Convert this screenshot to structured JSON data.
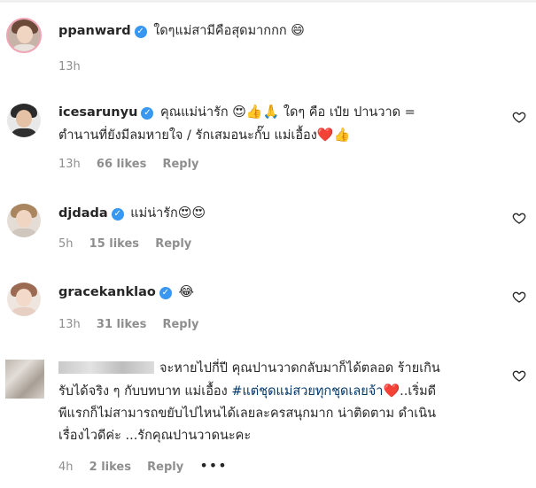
{
  "comments": [
    {
      "username": "ppanward",
      "text": "ใดๆแม่สามีคือสุดมากกก",
      "emoji": "😄",
      "time": "13h"
    },
    {
      "username": "icesarunyu",
      "text_a": "คุณแม่น่ารัก",
      "emoji_a": "😍👍🙏",
      "text_b": "ใดๆ คือ เป๋ย ปานวาด =",
      "text_line2": "ตำนานที่ยังมีลมหายใจ / รักเสมอนะกั๊บ แม่เอื้อง",
      "emoji_end": "❤️👍",
      "time": "13h",
      "likes": "66 likes",
      "reply": "Reply"
    },
    {
      "username": "djdada",
      "text": "แม่น่ารัก",
      "emoji": "😍😍",
      "time": "5h",
      "likes": "15 likes",
      "reply": "Reply"
    },
    {
      "username": "gracekanklao",
      "text": "",
      "emoji": "😂",
      "time": "13h",
      "likes": "31 likes",
      "reply": "Reply"
    },
    {
      "line1": "จะหายไปกี่ปี คุณปานวาดกลับมาก็ได้ตลอด ร้ายเกิน",
      "line2_a": "รับได้จริง ๆ กับบทบาท แม่เอื้อง",
      "hashtag": "#แต่ชุดแม่สวยทุกชุดเลยจ้า",
      "line2_heart": "❤️",
      "line2_b": "..เริ่มดี",
      "line3": "พีแรกก็ไม่สามารถขยับไปไหนได้เลยละครสนุกมาก น่าติดตาม ดำเนิน",
      "line4": "เรื่องไวดีค่ะ ...รักคุณปานวาดนะคะ",
      "time": "4h",
      "likes": "2 likes",
      "reply": "Reply",
      "more": "•••"
    }
  ],
  "icons": {
    "verified": "verified-badge",
    "like": "heart-outline",
    "verified_glyph": "✓"
  }
}
